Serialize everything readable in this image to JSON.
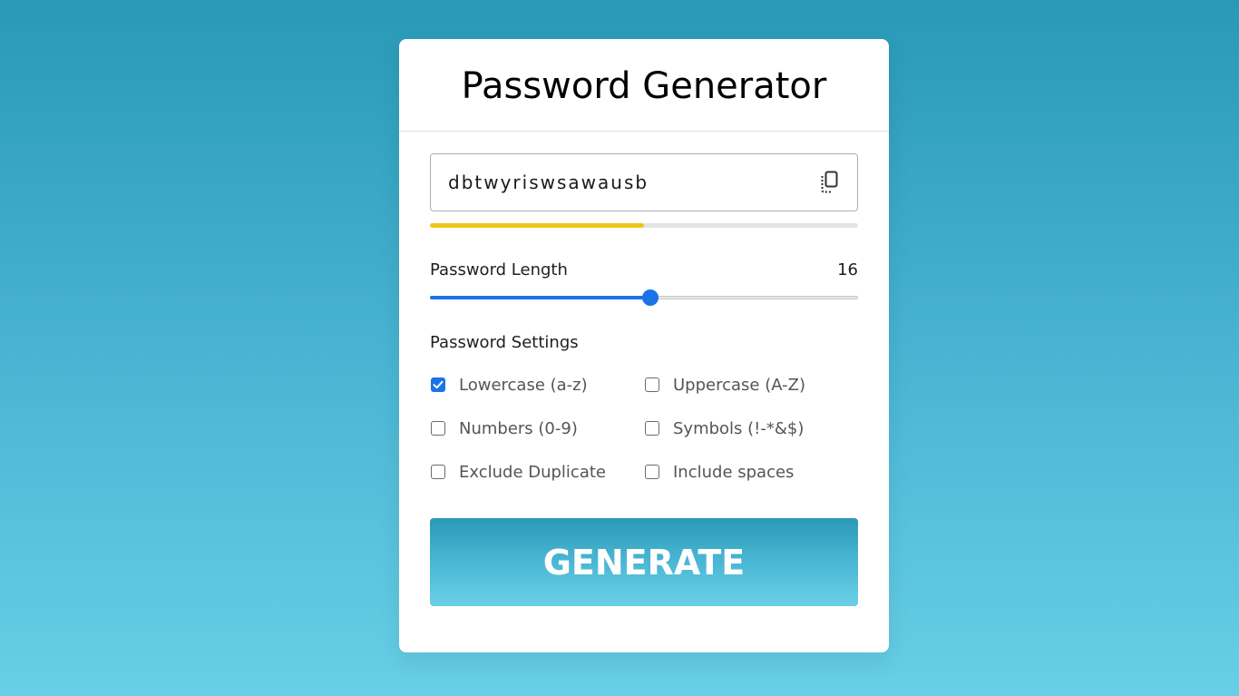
{
  "header": {
    "title": "Password Generator"
  },
  "password": {
    "value": "dbtwyriswsawausb",
    "copy_icon": "copy-icon",
    "strength_fraction": 0.5,
    "strength_color": "#f0c419"
  },
  "length": {
    "label": "Password Length",
    "value": "16",
    "slider_fraction": 0.515,
    "accent": "#1a73e8"
  },
  "settings": {
    "label": "Password Settings",
    "options": [
      {
        "label": "Lowercase (a-z)",
        "checked": true
      },
      {
        "label": "Uppercase (A-Z)",
        "checked": false
      },
      {
        "label": "Numbers (0-9)",
        "checked": false
      },
      {
        "label": "Symbols (!-*&$)",
        "checked": false
      },
      {
        "label": "Exclude Duplicate",
        "checked": false
      },
      {
        "label": "Include spaces",
        "checked": false
      }
    ]
  },
  "actions": {
    "generate_label": "GENERATE"
  }
}
